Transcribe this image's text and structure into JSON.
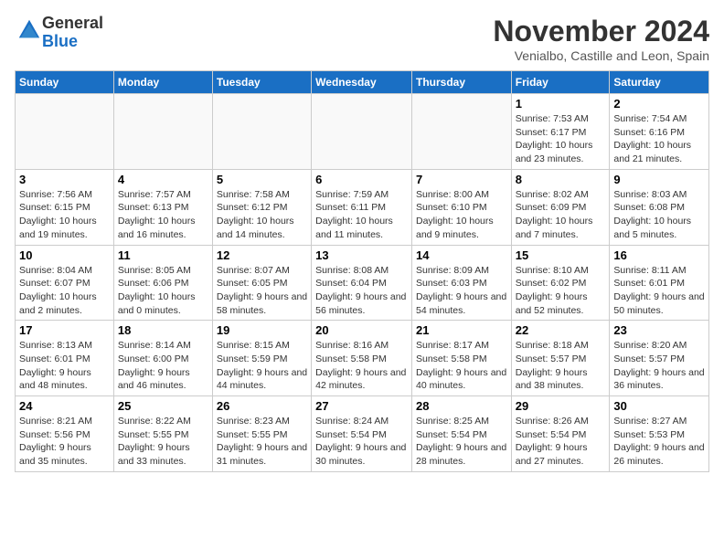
{
  "header": {
    "logo_general": "General",
    "logo_blue": "Blue",
    "month": "November 2024",
    "location": "Venialbo, Castille and Leon, Spain"
  },
  "weekdays": [
    "Sunday",
    "Monday",
    "Tuesday",
    "Wednesday",
    "Thursday",
    "Friday",
    "Saturday"
  ],
  "weeks": [
    [
      {
        "day": "",
        "info": ""
      },
      {
        "day": "",
        "info": ""
      },
      {
        "day": "",
        "info": ""
      },
      {
        "day": "",
        "info": ""
      },
      {
        "day": "",
        "info": ""
      },
      {
        "day": "1",
        "info": "Sunrise: 7:53 AM\nSunset: 6:17 PM\nDaylight: 10 hours and 23 minutes."
      },
      {
        "day": "2",
        "info": "Sunrise: 7:54 AM\nSunset: 6:16 PM\nDaylight: 10 hours and 21 minutes."
      }
    ],
    [
      {
        "day": "3",
        "info": "Sunrise: 7:56 AM\nSunset: 6:15 PM\nDaylight: 10 hours and 19 minutes."
      },
      {
        "day": "4",
        "info": "Sunrise: 7:57 AM\nSunset: 6:13 PM\nDaylight: 10 hours and 16 minutes."
      },
      {
        "day": "5",
        "info": "Sunrise: 7:58 AM\nSunset: 6:12 PM\nDaylight: 10 hours and 14 minutes."
      },
      {
        "day": "6",
        "info": "Sunrise: 7:59 AM\nSunset: 6:11 PM\nDaylight: 10 hours and 11 minutes."
      },
      {
        "day": "7",
        "info": "Sunrise: 8:00 AM\nSunset: 6:10 PM\nDaylight: 10 hours and 9 minutes."
      },
      {
        "day": "8",
        "info": "Sunrise: 8:02 AM\nSunset: 6:09 PM\nDaylight: 10 hours and 7 minutes."
      },
      {
        "day": "9",
        "info": "Sunrise: 8:03 AM\nSunset: 6:08 PM\nDaylight: 10 hours and 5 minutes."
      }
    ],
    [
      {
        "day": "10",
        "info": "Sunrise: 8:04 AM\nSunset: 6:07 PM\nDaylight: 10 hours and 2 minutes."
      },
      {
        "day": "11",
        "info": "Sunrise: 8:05 AM\nSunset: 6:06 PM\nDaylight: 10 hours and 0 minutes."
      },
      {
        "day": "12",
        "info": "Sunrise: 8:07 AM\nSunset: 6:05 PM\nDaylight: 9 hours and 58 minutes."
      },
      {
        "day": "13",
        "info": "Sunrise: 8:08 AM\nSunset: 6:04 PM\nDaylight: 9 hours and 56 minutes."
      },
      {
        "day": "14",
        "info": "Sunrise: 8:09 AM\nSunset: 6:03 PM\nDaylight: 9 hours and 54 minutes."
      },
      {
        "day": "15",
        "info": "Sunrise: 8:10 AM\nSunset: 6:02 PM\nDaylight: 9 hours and 52 minutes."
      },
      {
        "day": "16",
        "info": "Sunrise: 8:11 AM\nSunset: 6:01 PM\nDaylight: 9 hours and 50 minutes."
      }
    ],
    [
      {
        "day": "17",
        "info": "Sunrise: 8:13 AM\nSunset: 6:01 PM\nDaylight: 9 hours and 48 minutes."
      },
      {
        "day": "18",
        "info": "Sunrise: 8:14 AM\nSunset: 6:00 PM\nDaylight: 9 hours and 46 minutes."
      },
      {
        "day": "19",
        "info": "Sunrise: 8:15 AM\nSunset: 5:59 PM\nDaylight: 9 hours and 44 minutes."
      },
      {
        "day": "20",
        "info": "Sunrise: 8:16 AM\nSunset: 5:58 PM\nDaylight: 9 hours and 42 minutes."
      },
      {
        "day": "21",
        "info": "Sunrise: 8:17 AM\nSunset: 5:58 PM\nDaylight: 9 hours and 40 minutes."
      },
      {
        "day": "22",
        "info": "Sunrise: 8:18 AM\nSunset: 5:57 PM\nDaylight: 9 hours and 38 minutes."
      },
      {
        "day": "23",
        "info": "Sunrise: 8:20 AM\nSunset: 5:57 PM\nDaylight: 9 hours and 36 minutes."
      }
    ],
    [
      {
        "day": "24",
        "info": "Sunrise: 8:21 AM\nSunset: 5:56 PM\nDaylight: 9 hours and 35 minutes."
      },
      {
        "day": "25",
        "info": "Sunrise: 8:22 AM\nSunset: 5:55 PM\nDaylight: 9 hours and 33 minutes."
      },
      {
        "day": "26",
        "info": "Sunrise: 8:23 AM\nSunset: 5:55 PM\nDaylight: 9 hours and 31 minutes."
      },
      {
        "day": "27",
        "info": "Sunrise: 8:24 AM\nSunset: 5:54 PM\nDaylight: 9 hours and 30 minutes."
      },
      {
        "day": "28",
        "info": "Sunrise: 8:25 AM\nSunset: 5:54 PM\nDaylight: 9 hours and 28 minutes."
      },
      {
        "day": "29",
        "info": "Sunrise: 8:26 AM\nSunset: 5:54 PM\nDaylight: 9 hours and 27 minutes."
      },
      {
        "day": "30",
        "info": "Sunrise: 8:27 AM\nSunset: 5:53 PM\nDaylight: 9 hours and 26 minutes."
      }
    ]
  ]
}
